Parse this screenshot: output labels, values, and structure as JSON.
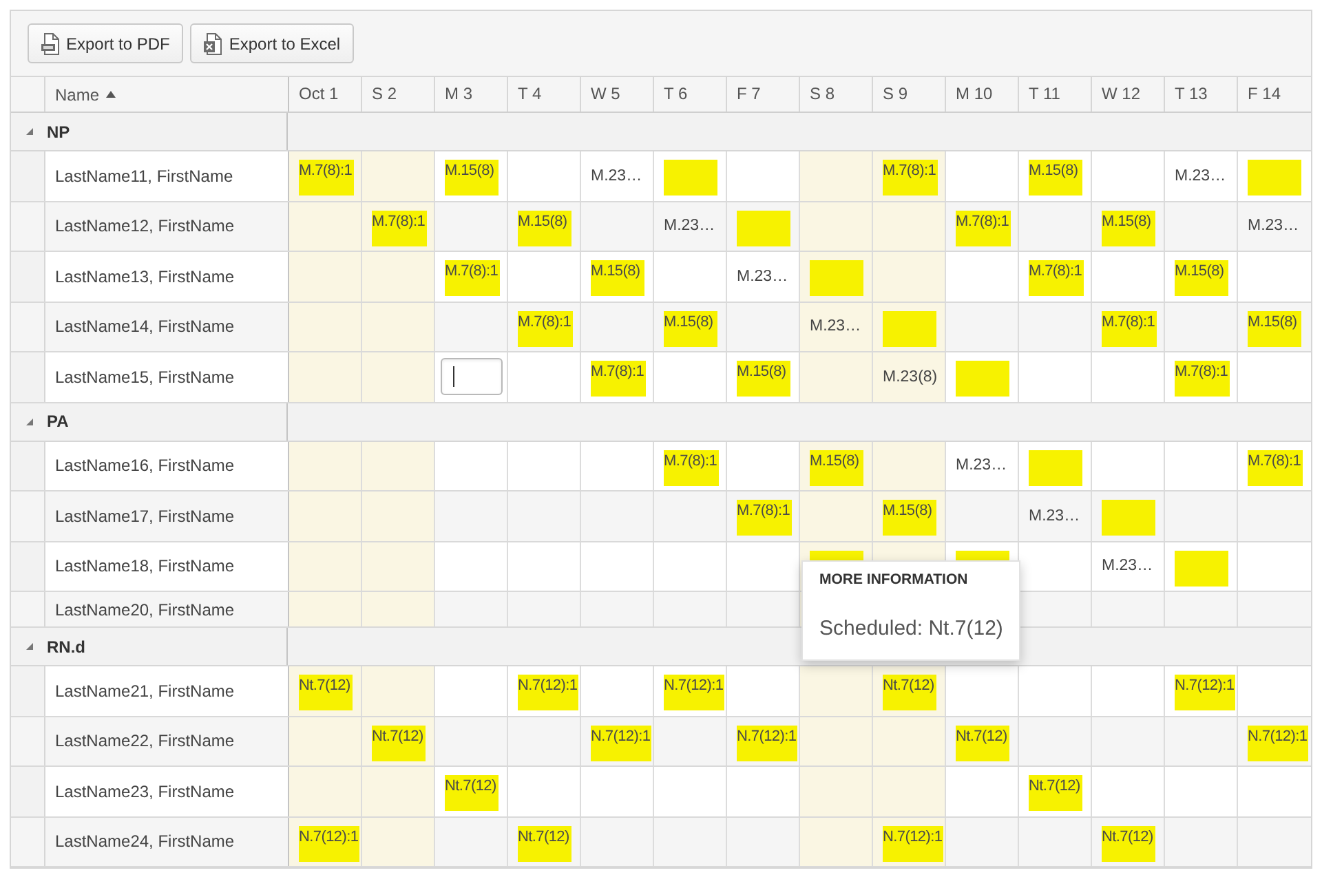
{
  "toolbar": {
    "buttons": [
      {
        "label": "Export to PDF",
        "kind": "pdf"
      },
      {
        "label": "Export to Excel",
        "kind": "excel"
      }
    ]
  },
  "grid": {
    "name_header": {
      "label": "Name",
      "sorted_ascending": true
    },
    "days": [
      {
        "label": "Oct 1",
        "weekend": true
      },
      {
        "label": "S 2",
        "weekend": true
      },
      {
        "label": "M 3",
        "weekend": false
      },
      {
        "label": "T 4",
        "weekend": false
      },
      {
        "label": "W 5",
        "weekend": false
      },
      {
        "label": "T 6",
        "weekend": false
      },
      {
        "label": "F 7",
        "weekend": false
      },
      {
        "label": "S 8",
        "weekend": true
      },
      {
        "label": "S 9",
        "weekend": true
      },
      {
        "label": "M 10",
        "weekend": false
      },
      {
        "label": "T 11",
        "weekend": false
      },
      {
        "label": "W 12",
        "weekend": false
      },
      {
        "label": "T 13",
        "weekend": false
      },
      {
        "label": "F 14",
        "weekend": false
      }
    ],
    "groups": [
      {
        "name": "NP",
        "expanded": true,
        "rows": [
          {
            "name": "LastName11, FirstName",
            "cells": [
              {
                "kind": "shift",
                "text": "M.7(8):1"
              },
              {
                "kind": "empty"
              },
              {
                "kind": "shift",
                "text": "M.15(8)"
              },
              {
                "kind": "empty"
              },
              {
                "kind": "note",
                "text": "M.23…"
              },
              {
                "kind": "shift"
              },
              {
                "kind": "empty"
              },
              {
                "kind": "empty"
              },
              {
                "kind": "shift",
                "text": "M.7(8):1"
              },
              {
                "kind": "empty"
              },
              {
                "kind": "shift",
                "text": "M.15(8)"
              },
              {
                "kind": "empty"
              },
              {
                "kind": "note",
                "text": "M.23…"
              },
              {
                "kind": "shift"
              }
            ]
          },
          {
            "name": "LastName12, FirstName",
            "cells": [
              {
                "kind": "empty"
              },
              {
                "kind": "shift",
                "text": "M.7(8):1"
              },
              {
                "kind": "empty"
              },
              {
                "kind": "shift",
                "text": "M.15(8)"
              },
              {
                "kind": "empty"
              },
              {
                "kind": "note",
                "text": "M.23…"
              },
              {
                "kind": "shift"
              },
              {
                "kind": "empty"
              },
              {
                "kind": "empty"
              },
              {
                "kind": "shift",
                "text": "M.7(8):1"
              },
              {
                "kind": "empty"
              },
              {
                "kind": "shift",
                "text": "M.15(8)"
              },
              {
                "kind": "empty"
              },
              {
                "kind": "note",
                "text": "M.23…"
              }
            ]
          },
          {
            "name": "LastName13, FirstName",
            "cells": [
              {
                "kind": "empty"
              },
              {
                "kind": "empty"
              },
              {
                "kind": "shift",
                "text": "M.7(8):1"
              },
              {
                "kind": "empty"
              },
              {
                "kind": "shift",
                "text": "M.15(8)"
              },
              {
                "kind": "empty"
              },
              {
                "kind": "note",
                "text": "M.23…"
              },
              {
                "kind": "shift"
              },
              {
                "kind": "empty"
              },
              {
                "kind": "empty"
              },
              {
                "kind": "shift",
                "text": "M.7(8):1"
              },
              {
                "kind": "empty"
              },
              {
                "kind": "shift",
                "text": "M.15(8)"
              },
              {
                "kind": "empty"
              }
            ]
          },
          {
            "name": "LastName14, FirstName",
            "cells": [
              {
                "kind": "empty"
              },
              {
                "kind": "empty"
              },
              {
                "kind": "empty"
              },
              {
                "kind": "shift",
                "text": "M.7(8):1"
              },
              {
                "kind": "empty"
              },
              {
                "kind": "shift",
                "text": "M.15(8)"
              },
              {
                "kind": "empty"
              },
              {
                "kind": "note",
                "text": "M.23…"
              },
              {
                "kind": "shift"
              },
              {
                "kind": "empty"
              },
              {
                "kind": "empty"
              },
              {
                "kind": "shift",
                "text": "M.7(8):1"
              },
              {
                "kind": "empty"
              },
              {
                "kind": "shift",
                "text": "M.15(8)"
              }
            ]
          },
          {
            "name": "LastName15, FirstName",
            "cells": [
              {
                "kind": "empty"
              },
              {
                "kind": "empty"
              },
              {
                "kind": "input"
              },
              {
                "kind": "empty"
              },
              {
                "kind": "shift",
                "text": "M.7(8):1"
              },
              {
                "kind": "empty"
              },
              {
                "kind": "shift",
                "text": "M.15(8)"
              },
              {
                "kind": "empty"
              },
              {
                "kind": "note",
                "text": "M.23(8)"
              },
              {
                "kind": "shift"
              },
              {
                "kind": "empty"
              },
              {
                "kind": "empty"
              },
              {
                "kind": "shift",
                "text": "M.7(8):1"
              },
              {
                "kind": "empty"
              }
            ]
          }
        ]
      },
      {
        "name": "PA",
        "expanded": true,
        "rows": [
          {
            "name": "LastName16, FirstName",
            "cells": [
              {
                "kind": "empty"
              },
              {
                "kind": "empty"
              },
              {
                "kind": "empty"
              },
              {
                "kind": "empty"
              },
              {
                "kind": "empty"
              },
              {
                "kind": "shift",
                "text": "M.7(8):1"
              },
              {
                "kind": "empty"
              },
              {
                "kind": "shift",
                "text": "M.15(8)"
              },
              {
                "kind": "empty"
              },
              {
                "kind": "note",
                "text": "M.23…"
              },
              {
                "kind": "shift"
              },
              {
                "kind": "empty"
              },
              {
                "kind": "empty"
              },
              {
                "kind": "shift",
                "text": "M.7(8):1"
              }
            ]
          },
          {
            "name": "LastName17, FirstName",
            "cells": [
              {
                "kind": "empty"
              },
              {
                "kind": "empty"
              },
              {
                "kind": "empty"
              },
              {
                "kind": "empty"
              },
              {
                "kind": "empty"
              },
              {
                "kind": "empty"
              },
              {
                "kind": "shift",
                "text": "M.7(8):1"
              },
              {
                "kind": "empty"
              },
              {
                "kind": "shift",
                "text": "M.15(8)"
              },
              {
                "kind": "empty"
              },
              {
                "kind": "note",
                "text": "M.23…"
              },
              {
                "kind": "shift"
              },
              {
                "kind": "empty"
              },
              {
                "kind": "empty"
              }
            ]
          },
          {
            "name": "LastName18, FirstName",
            "cells": [
              {
                "kind": "empty"
              },
              {
                "kind": "empty"
              },
              {
                "kind": "empty"
              },
              {
                "kind": "empty"
              },
              {
                "kind": "empty"
              },
              {
                "kind": "empty"
              },
              {
                "kind": "empty"
              },
              {
                "kind": "shift"
              },
              {
                "kind": "empty"
              },
              {
                "kind": "shift"
              },
              {
                "kind": "empty"
              },
              {
                "kind": "note",
                "text": "M.23…"
              },
              {
                "kind": "shift"
              },
              {
                "kind": "empty"
              }
            ]
          },
          {
            "name": "LastName20, FirstName",
            "cells": [
              {
                "kind": "empty"
              },
              {
                "kind": "empty"
              },
              {
                "kind": "empty"
              },
              {
                "kind": "empty"
              },
              {
                "kind": "empty"
              },
              {
                "kind": "empty"
              },
              {
                "kind": "empty"
              },
              {
                "kind": "empty"
              },
              {
                "kind": "empty"
              },
              {
                "kind": "empty"
              },
              {
                "kind": "empty"
              },
              {
                "kind": "empty"
              },
              {
                "kind": "empty"
              },
              {
                "kind": "empty"
              }
            ]
          }
        ]
      },
      {
        "name": "RN.d",
        "expanded": true,
        "rows": [
          {
            "name": "LastName21, FirstName",
            "cells": [
              {
                "kind": "shift",
                "text": "Nt.7(12)"
              },
              {
                "kind": "empty"
              },
              {
                "kind": "empty"
              },
              {
                "kind": "shift",
                "text": "N.7(12):1"
              },
              {
                "kind": "empty"
              },
              {
                "kind": "shift",
                "text": "N.7(12):1"
              },
              {
                "kind": "empty"
              },
              {
                "kind": "empty"
              },
              {
                "kind": "shift",
                "text": "Nt.7(12)"
              },
              {
                "kind": "empty"
              },
              {
                "kind": "empty"
              },
              {
                "kind": "empty"
              },
              {
                "kind": "shift",
                "text": "N.7(12):1"
              },
              {
                "kind": "empty"
              }
            ]
          },
          {
            "name": "LastName22, FirstName",
            "cells": [
              {
                "kind": "empty"
              },
              {
                "kind": "shift",
                "text": "Nt.7(12)"
              },
              {
                "kind": "empty"
              },
              {
                "kind": "empty"
              },
              {
                "kind": "shift",
                "text": "N.7(12):1"
              },
              {
                "kind": "empty"
              },
              {
                "kind": "shift",
                "text": "N.7(12):1"
              },
              {
                "kind": "empty"
              },
              {
                "kind": "empty"
              },
              {
                "kind": "shift",
                "text": "Nt.7(12)"
              },
              {
                "kind": "empty"
              },
              {
                "kind": "empty"
              },
              {
                "kind": "empty"
              },
              {
                "kind": "shift",
                "text": "N.7(12):1"
              }
            ]
          },
          {
            "name": "LastName23, FirstName",
            "cells": [
              {
                "kind": "empty"
              },
              {
                "kind": "empty"
              },
              {
                "kind": "shift",
                "text": "Nt.7(12)"
              },
              {
                "kind": "empty"
              },
              {
                "kind": "empty"
              },
              {
                "kind": "empty"
              },
              {
                "kind": "empty"
              },
              {
                "kind": "empty"
              },
              {
                "kind": "empty"
              },
              {
                "kind": "empty"
              },
              {
                "kind": "shift",
                "text": "Nt.7(12)"
              },
              {
                "kind": "empty"
              },
              {
                "kind": "empty"
              },
              {
                "kind": "empty"
              }
            ]
          },
          {
            "name": "LastName24, FirstName",
            "cells": [
              {
                "kind": "shift",
                "text": "N.7(12):1"
              },
              {
                "kind": "empty"
              },
              {
                "kind": "empty"
              },
              {
                "kind": "shift",
                "text": "Nt.7(12)"
              },
              {
                "kind": "empty"
              },
              {
                "kind": "empty"
              },
              {
                "kind": "empty"
              },
              {
                "kind": "empty"
              },
              {
                "kind": "shift",
                "text": "N.7(12):1"
              },
              {
                "kind": "empty"
              },
              {
                "kind": "empty"
              },
              {
                "kind": "shift",
                "text": "Nt.7(12)"
              },
              {
                "kind": "empty"
              },
              {
                "kind": "empty"
              }
            ]
          }
        ]
      }
    ]
  },
  "tooltip": {
    "title": "MORE INFORMATION",
    "text": "Scheduled: Nt.7(12)"
  }
}
